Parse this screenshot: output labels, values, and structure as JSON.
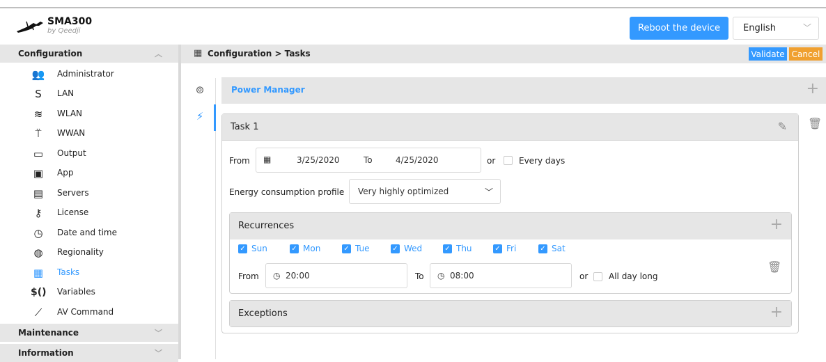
{
  "header": {
    "brand": "SMA300",
    "brand_sub": "by Qeedji",
    "reboot_label": "Reboot the device",
    "language": "English"
  },
  "sidebar": {
    "config_title": "Configuration",
    "items": [
      {
        "label": "Administrator",
        "icon": "👥"
      },
      {
        "label": "LAN",
        "icon": "S"
      },
      {
        "label": "WLAN",
        "icon": "≋"
      },
      {
        "label": "WWAN",
        "icon": "⍡"
      },
      {
        "label": "Output",
        "icon": "▭"
      },
      {
        "label": "App",
        "icon": "▣"
      },
      {
        "label": "Servers",
        "icon": "▤"
      },
      {
        "label": "License",
        "icon": "⚷"
      },
      {
        "label": "Date and time",
        "icon": "◷"
      },
      {
        "label": "Regionality",
        "icon": "◍"
      },
      {
        "label": "Tasks",
        "icon": "▦"
      },
      {
        "label": "Variables",
        "icon": "$()"
      },
      {
        "label": "AV Command",
        "icon": "⟋"
      }
    ],
    "maintenance_title": "Maintenance",
    "information_title": "Information"
  },
  "breadcrumb": {
    "text": "Configuration > Tasks",
    "validate_label": "Validate",
    "cancel_label": "Cancel"
  },
  "power_manager": {
    "title": "Power Manager"
  },
  "task": {
    "title": "Task 1",
    "from_label": "From",
    "from_date": "3/25/2020",
    "to_label": "To",
    "to_date": "4/25/2020",
    "or_label": "or",
    "every_days_label": "Every days",
    "every_days_checked": false,
    "profile_label": "Energy consumption profile",
    "profile_value": "Very highly optimized"
  },
  "recurrences": {
    "title": "Recurrences",
    "days": [
      {
        "label": "Sun",
        "checked": true
      },
      {
        "label": "Mon",
        "checked": true
      },
      {
        "label": "Tue",
        "checked": true
      },
      {
        "label": "Wed",
        "checked": true
      },
      {
        "label": "Thu",
        "checked": true
      },
      {
        "label": "Fri",
        "checked": true
      },
      {
        "label": "Sat",
        "checked": true
      }
    ],
    "from_label": "From",
    "from_time": "20:00",
    "to_label": "To",
    "to_time": "08:00",
    "or_label": "or",
    "all_day_label": "All day long",
    "all_day_checked": false
  },
  "exceptions": {
    "title": "Exceptions"
  },
  "colors": {
    "accent": "#3399ff",
    "cancel": "#f0a030",
    "header_gray": "#e6e6e6"
  }
}
